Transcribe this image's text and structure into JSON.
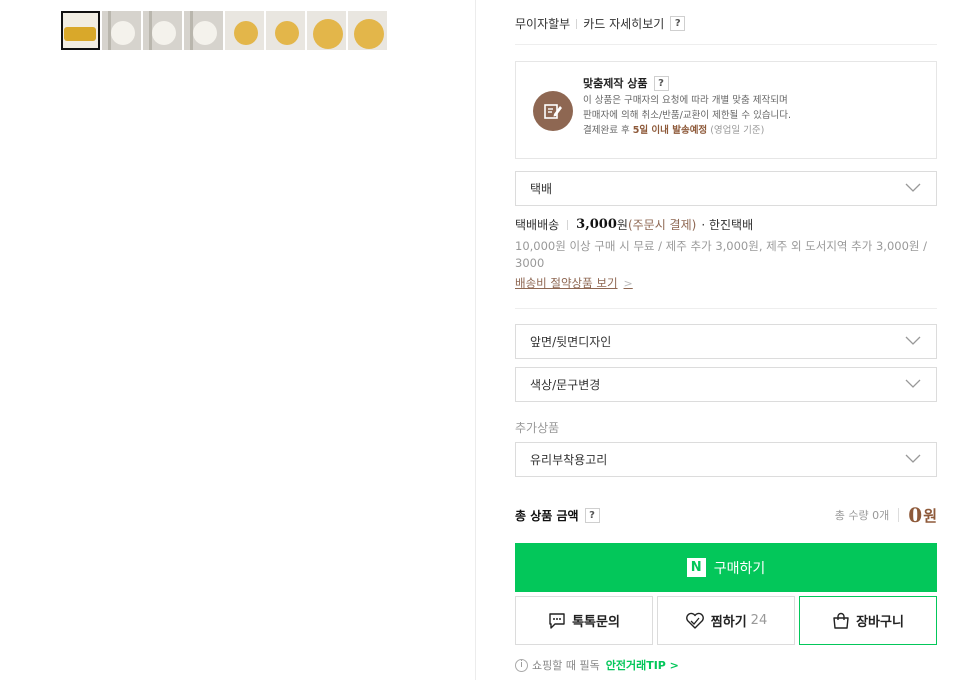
{
  "gallery": {
    "thumbnails": [
      {
        "label": "thumb-1"
      },
      {
        "label": "thumb-2"
      },
      {
        "label": "thumb-3"
      },
      {
        "label": "thumb-4"
      },
      {
        "label": "thumb-5"
      },
      {
        "label": "thumb-6"
      },
      {
        "label": "thumb-7"
      },
      {
        "label": "thumb-8"
      }
    ],
    "active_index": 0
  },
  "payment": {
    "installment_label": "무이자할부",
    "card_detail_label": "카드 자세히보기",
    "help_icon": "?"
  },
  "custom_product": {
    "icon": "pencil-note-icon",
    "title": "맞춤제작 상품",
    "help_icon": "?",
    "line1": "이 상품은 구매자의 요청에 따라 개별 맞춤 제작되며",
    "line2": "판매자에 의해 취소/반품/교환이 제한될 수 있습니다.",
    "line3_prefix": "결제완료 후",
    "line3_highlight": "5일 이내 발송예정",
    "line3_suffix": "(영업일 기준)"
  },
  "delivery": {
    "method_selected": "택배",
    "label": "택배배송",
    "price": "3,000",
    "price_unit": "원",
    "payment_note": "(주문시 결제)",
    "courier": "· 한진택배",
    "note": "10,000원 이상 구매 시 무료 / 제주 추가 3,000원, 제주 외 도서지역 추가 3,000원 / 3000",
    "saving_link": "배송비 절약상품 보기",
    "saving_arrow": ">"
  },
  "options": {
    "design_selected": "앞면/뒷면디자인",
    "color_selected": "색상/문구변경"
  },
  "extra": {
    "label": "추가상품",
    "hook_selected": "유리부착용고리"
  },
  "total": {
    "label": "총 상품 금액",
    "help_icon": "?",
    "quantity_text": "총 수량 0개",
    "amount": "0",
    "unit": "원"
  },
  "actions": {
    "buy_logo": "N",
    "buy_label": "구매하기",
    "talk_label": "톡톡문의",
    "wish_label": "찜하기",
    "wish_count": "24",
    "cart_label": "장바구니"
  },
  "footer_tip": {
    "info_icon": "i",
    "text": "쇼핑할 때 필독",
    "link": "안전거래TIP >"
  },
  "colors": {
    "brand_green": "#03c75a",
    "accent_brown": "#8e5a3a"
  }
}
